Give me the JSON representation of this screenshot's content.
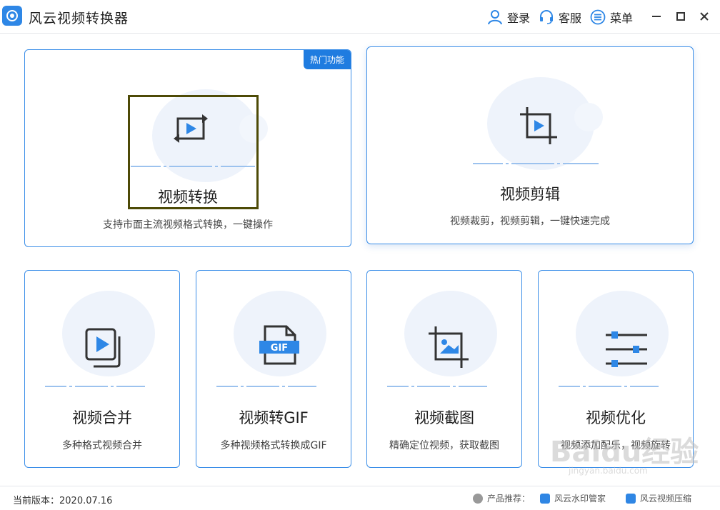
{
  "app": {
    "title": "风云视频转换器",
    "actions": {
      "login": "登录",
      "service": "客服",
      "menu": "菜单"
    },
    "accent": "#1f7ce0"
  },
  "cards": {
    "convert": {
      "title": "视频转换",
      "desc": "支持市面主流视频格式转换，一键操作",
      "badge": "热门功能",
      "icon": "convert-play-icon"
    },
    "edit": {
      "title": "视频剪辑",
      "desc": "视频裁剪，视频剪辑，一键快速完成",
      "icon": "crop-play-icon"
    },
    "merge": {
      "title": "视频合并",
      "desc": "多种格式视频合并",
      "icon": "stacked-play-icon"
    },
    "gif": {
      "title": "视频转GIF",
      "desc": "多种视频格式转换成GIF",
      "icon": "gif-file-icon",
      "icon_label": "GIF"
    },
    "screenshot": {
      "title": "视频截图",
      "desc": "精确定位视频，获取截图",
      "icon": "crop-image-icon"
    },
    "optimize": {
      "title": "视频优化",
      "desc": "视频添加配乐，视频旋转",
      "icon": "sliders-icon"
    }
  },
  "footer": {
    "version": "当前版本：2020.07.16",
    "rec_label": "产品推荐：",
    "products": [
      "风云水印管家",
      "风云视频压缩"
    ]
  },
  "watermark": {
    "brand": "Baidu经验",
    "url": "jingyan.baidu.com"
  }
}
